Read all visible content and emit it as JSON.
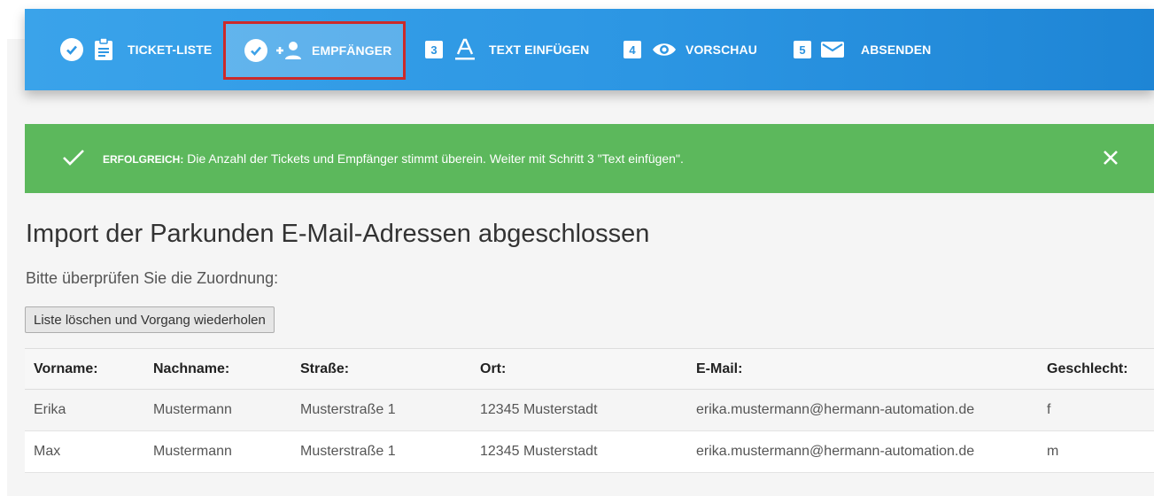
{
  "steps": [
    {
      "label": "TICKET-LISTE",
      "state": "done",
      "icon": "clipboard-icon"
    },
    {
      "label": "EMPFÄNGER",
      "state": "active",
      "icon": "add-person-icon"
    },
    {
      "label": "TEXT EINFÜGEN",
      "number": "3",
      "icon": "text-format-icon"
    },
    {
      "label": "VORSCHAU",
      "number": "4",
      "icon": "eye-icon"
    },
    {
      "label": "ABSENDEN",
      "number": "5",
      "icon": "mail-icon"
    }
  ],
  "alert": {
    "title": "ERFOLGREICH:",
    "message": " Die Anzahl der Tickets und Empfänger stimmt überein. Weiter mit Schritt 3 \"Text einfügen\".",
    "color": "#5cb85c"
  },
  "heading": "Import der Parkunden E-Mail-Adressen abgeschlossen",
  "subheading": "Bitte überprüfen Sie die Zuordnung:",
  "reset_button": "Liste löschen und Vorgang wiederholen",
  "table": {
    "headers": [
      "Vorname:",
      "Nachname:",
      "Straße:",
      "Ort:",
      "E-Mail:",
      "Geschlecht:"
    ],
    "rows": [
      [
        "Erika",
        "Mustermann",
        "Musterstraße 1",
        "12345 Musterstadt",
        "erika.mustermann@hermann-automation.de",
        "f"
      ],
      [
        "Max",
        "Mustermann",
        "Musterstraße 1",
        "12345 Musterstadt",
        "erika.mustermann@hermann-automation.de",
        "m"
      ]
    ]
  },
  "colors": {
    "stepbar": "#2c96e3",
    "active_border": "#cc2a2a"
  }
}
